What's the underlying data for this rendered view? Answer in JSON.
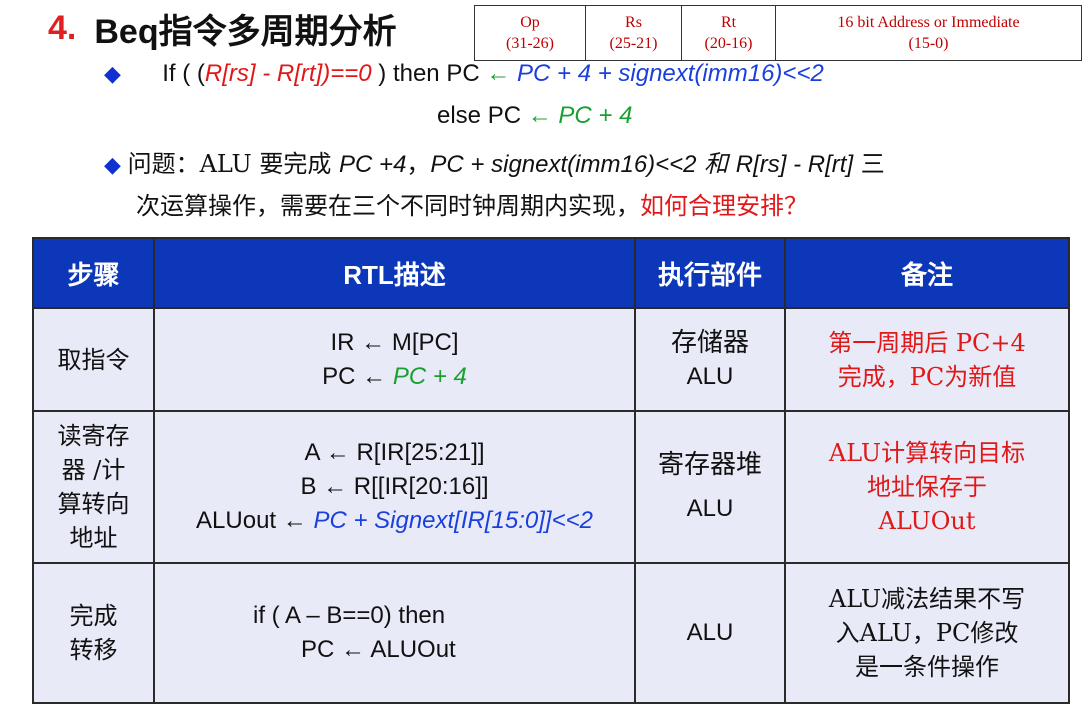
{
  "title": {
    "number": "4.",
    "text": "Beq指令多周期分析"
  },
  "instruction_format": [
    {
      "name": "Op",
      "bits": "(31-26)"
    },
    {
      "name": "Rs",
      "bits": "(25-21)"
    },
    {
      "name": "Rt",
      "bits": "(20-16)"
    },
    {
      "name": "16 bit Address or Immediate",
      "bits": "(15-0)"
    }
  ],
  "bullets": {
    "b1": {
      "if_prefix": "If ( (",
      "cond": "R[rs] - R[rt])==0",
      "then_text": " ) then PC ",
      "arrow": "←",
      "pc_target": " PC + 4 + signext(imm16)<<2",
      "else_text": "else PC ",
      "pc_next": " PC + 4"
    },
    "b2": {
      "q_label": "问题：ALU 要完成 ",
      "op1": "PC +4",
      "sep1": "，",
      "op2": "PC + signext(imm16)<<2",
      "and": " 和 ",
      "op3": "R[rs] - R[rt]",
      "tail1": " 三",
      "line2": "次运算操作，需要在三个不同时钟周期内实现，",
      "question": "如何合理安排？"
    }
  },
  "table": {
    "headers": [
      "步骤",
      "RTL描述",
      "执行部件",
      "备注"
    ],
    "rows": [
      {
        "step": [
          "取指令"
        ],
        "rtl": [
          {
            "pre": "IR ← M[PC]",
            "hl": ""
          },
          {
            "pre": "PC ← ",
            "hl": "PC + 4"
          }
        ],
        "unit": [
          "存储器",
          "ALU"
        ],
        "note": [
          "第一周期后 PC+4",
          "完成，PC为新值"
        ]
      },
      {
        "step": [
          "读寄存",
          "器 /计",
          "算转向",
          "地址"
        ],
        "rtl": [
          {
            "pre": "A ← R[IR[25:21]]",
            "hl": ""
          },
          {
            "pre": "B ← R[[IR[20:16]]",
            "hl": ""
          },
          {
            "pre": "ALUout ← ",
            "hl": "PC + Signext[IR[15:0]]<<2"
          }
        ],
        "unit": [
          "寄存器堆",
          "ALU"
        ],
        "note": [
          "ALU计算转向目标",
          "地址保存于",
          "ALUOut"
        ]
      },
      {
        "step": [
          "完成",
          "转移"
        ],
        "rtl": [
          {
            "pre": "if ( A – B==0) then",
            "hl": ""
          },
          {
            "pre": "PC ←  ALUOut",
            "hl": ""
          }
        ],
        "unit": [
          "ALU"
        ],
        "note": [
          "ALU减法结果不写",
          "入ALU，PC修改",
          "是一条件操作"
        ]
      }
    ]
  },
  "colors": {
    "header_bg": "#0b37b8",
    "row_bg": "#e8ebf7",
    "title_number": "#e02020",
    "bullet": "#1030d0",
    "highlight_red": "#e01818",
    "highlight_blue": "#1a3fdc",
    "highlight_green": "#18a030"
  }
}
